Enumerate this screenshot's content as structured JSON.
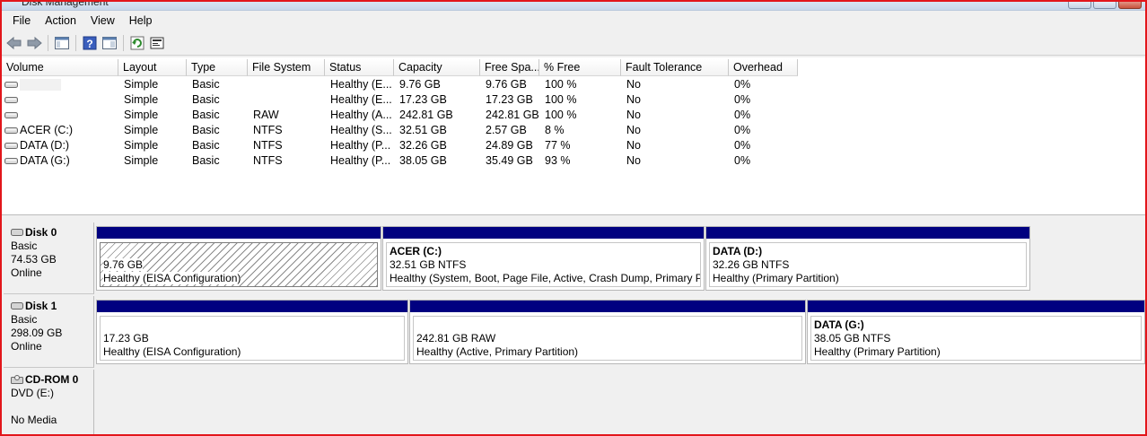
{
  "window": {
    "title": "Disk Management"
  },
  "menu": [
    "File",
    "Action",
    "View",
    "Help"
  ],
  "toolbar": {
    "icons": [
      "back-arrow-icon",
      "forward-arrow-icon",
      "console-tree-icon",
      "help-icon",
      "properties-icon",
      "refresh-icon",
      "rescan-disks-icon"
    ]
  },
  "volume_list": {
    "columns": [
      "Volume",
      "Layout",
      "Type",
      "File System",
      "Status",
      "Capacity",
      "Free Spa...",
      "% Free",
      "Fault Tolerance",
      "Overhead"
    ],
    "rows": [
      {
        "volume": "",
        "layout": "Simple",
        "type": "Basic",
        "fs": "",
        "status": "Healthy (E...",
        "capacity": "9.76 GB",
        "free": "9.76 GB",
        "pct": "100 %",
        "fault": "No",
        "overhead": "0%"
      },
      {
        "volume": "",
        "layout": "Simple",
        "type": "Basic",
        "fs": "",
        "status": "Healthy (E...",
        "capacity": "17.23 GB",
        "free": "17.23 GB",
        "pct": "100 %",
        "fault": "No",
        "overhead": "0%"
      },
      {
        "volume": "",
        "layout": "Simple",
        "type": "Basic",
        "fs": "RAW",
        "status": "Healthy (A...",
        "capacity": "242.81 GB",
        "free": "242.81 GB",
        "pct": "100 %",
        "fault": "No",
        "overhead": "0%"
      },
      {
        "volume": "ACER (C:)",
        "layout": "Simple",
        "type": "Basic",
        "fs": "NTFS",
        "status": "Healthy (S...",
        "capacity": "32.51 GB",
        "free": "2.57 GB",
        "pct": "8 %",
        "fault": "No",
        "overhead": "0%"
      },
      {
        "volume": "DATA (D:)",
        "layout": "Simple",
        "type": "Basic",
        "fs": "NTFS",
        "status": "Healthy (P...",
        "capacity": "32.26 GB",
        "free": "24.89 GB",
        "pct": "77 %",
        "fault": "No",
        "overhead": "0%"
      },
      {
        "volume": "DATA (G:)",
        "layout": "Simple",
        "type": "Basic",
        "fs": "NTFS",
        "status": "Healthy (P...",
        "capacity": "38.05 GB",
        "free": "35.49 GB",
        "pct": "93 %",
        "fault": "No",
        "overhead": "0%"
      }
    ]
  },
  "disks": [
    {
      "name": "Disk 0",
      "type": "Basic",
      "size": "74.53 GB",
      "status": "Online",
      "partitions": [
        {
          "name": "",
          "size": "9.76 GB",
          "status": "Healthy (EISA Configuration)",
          "hatched": true
        },
        {
          "name": "ACER  (C:)",
          "size": "32.51 GB NTFS",
          "status": "Healthy (System, Boot, Page File, Active, Crash Dump, Primary Pa"
        },
        {
          "name": "DATA  (D:)",
          "size": "32.26 GB NTFS",
          "status": "Healthy (Primary Partition)"
        }
      ]
    },
    {
      "name": "Disk 1",
      "type": "Basic",
      "size": "298.09 GB",
      "status": "Online",
      "partitions": [
        {
          "name": "",
          "size": "17.23 GB",
          "status": "Healthy (EISA Configuration)"
        },
        {
          "name": "",
          "size": "242.81 GB RAW",
          "status": "Healthy (Active, Primary Partition)"
        },
        {
          "name": "DATA  (G:)",
          "size": "38.05 GB NTFS",
          "status": "Healthy (Primary Partition)"
        }
      ]
    },
    {
      "name": "CD-ROM 0",
      "type": "DVD (E:)",
      "size": "",
      "status": "No Media"
    }
  ],
  "colors": {
    "partition_bar": "#000080",
    "frame_border": "#e2161b"
  }
}
